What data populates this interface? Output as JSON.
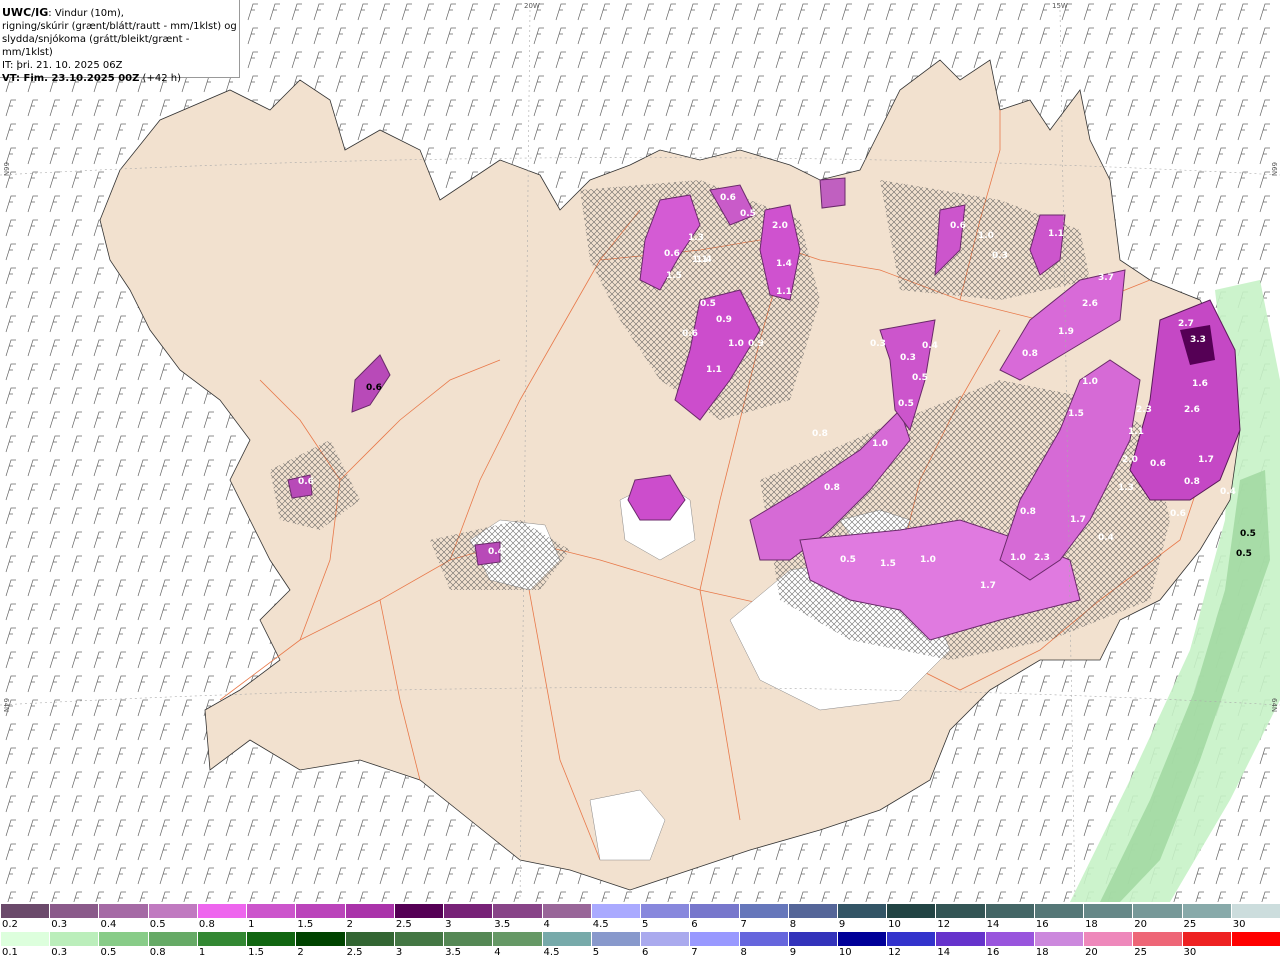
{
  "title_block": {
    "model": "UWC/IG",
    "line1": ": Vindur (10m),",
    "line2": "rigning/skúrir (grænt/blátt/rautt - mm/1klst) og",
    "line3": "slydda/snjókoma (grátt/bleikt/grænt - mm/1klst)",
    "it": "IT: þri. 21. 10. 2025 06Z",
    "vt_label": "VT: Fim. 23.10.2025 00Z",
    "vt_offset": " (+42 h)"
  },
  "grid_labels": {
    "lon_20w": "20W",
    "lon_15w": "15W",
    "lat_66n_left": "66N",
    "lat_66n_right": "66N",
    "lat_64n_left": "64N",
    "lat_64n_right": "64N"
  },
  "precip_values": [
    "0.6",
    "0.5",
    "1.3",
    "1.1",
    "2.0",
    "0.6",
    "1.5",
    "1.4",
    "1.4",
    "1.1",
    "0.5",
    "0.6",
    "0.9",
    "1.0",
    "0.9",
    "1.1",
    "0.3",
    "0.3",
    "0.5",
    "0.4",
    "0.5",
    "0.6",
    "1.0",
    "0.3",
    "1.1",
    "3.7",
    "2.6",
    "1.9",
    "0.8",
    "1.0",
    "0.8",
    "0.8",
    "1.0",
    "1.5",
    "2.7",
    "3.3",
    "1.6",
    "2.6",
    "2.3",
    "1.1",
    "2.0",
    "0.6",
    "1.3",
    "1.7",
    "0.8",
    "0.8",
    "1.0",
    "0.5",
    "1.5",
    "1.0",
    "1.7",
    "2.3",
    "1.7",
    "0.4",
    "0.6",
    "0.4",
    "0.4",
    "0.6",
    "0.5",
    "0.5",
    "0.6"
  ],
  "snow_legend": {
    "labels": [
      "0.2",
      "0.3",
      "0.4",
      "0.5",
      "0.8",
      "1",
      "1.5",
      "2",
      "2.5",
      "3",
      "3.5",
      "4",
      "4.5",
      "5",
      "6",
      "7",
      "8",
      "9",
      "10",
      "12",
      "14",
      "16",
      "18",
      "20",
      "25",
      "30"
    ],
    "colors": [
      "#6b4a6b",
      "#8a5a8a",
      "#a56aa5",
      "#c07ac0",
      "#ee66ee",
      "#cc55cc",
      "#bb44bb",
      "#aa33aa",
      "#550055",
      "#772277",
      "#884488",
      "#996699",
      "#aaaaff",
      "#8888dd",
      "#7777cc",
      "#6677bb",
      "#556699",
      "#335566",
      "#224444",
      "#335555",
      "#446666",
      "#557777",
      "#668888",
      "#779999",
      "#88aaaa",
      "#ccdddd"
    ]
  },
  "rain_legend": {
    "labels": [
      "0.1",
      "0.3",
      "0.5",
      "0.8",
      "1",
      "1.5",
      "2",
      "2.5",
      "3",
      "3.5",
      "4",
      "4.5",
      "5",
      "6",
      "7",
      "8",
      "9",
      "10",
      "12",
      "14",
      "16",
      "18",
      "20",
      "25",
      "30"
    ],
    "colors": [
      "#ddffdd",
      "#bbeebb",
      "#88cc88",
      "#66aa66",
      "#338833",
      "#116611",
      "#004400",
      "#336633",
      "#447744",
      "#558855",
      "#669966",
      "#77aaaa",
      "#8899cc",
      "#aaaaee",
      "#9999ff",
      "#6666dd",
      "#3333bb",
      "#000099",
      "#3333cc",
      "#6633cc",
      "#9955dd",
      "#cc88dd",
      "#ee88bb",
      "#ee6677",
      "#ee2222",
      "#ff0000"
    ]
  }
}
